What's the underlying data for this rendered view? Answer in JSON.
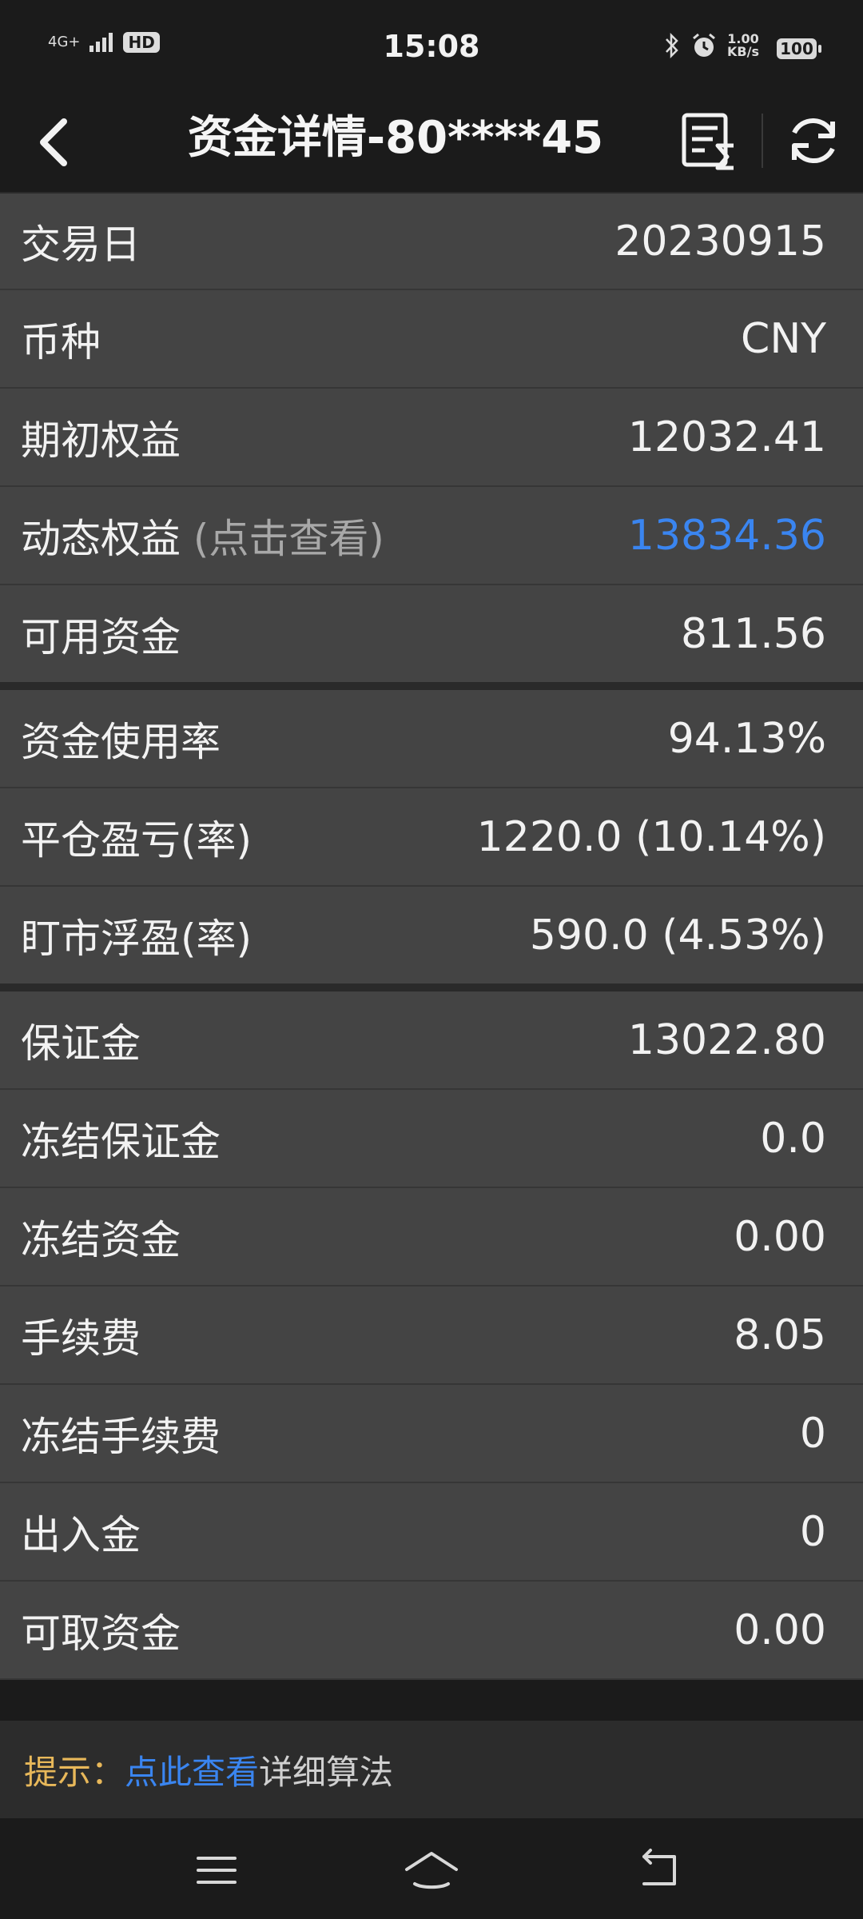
{
  "status": {
    "network": "4G+",
    "hd": "HD",
    "time": "15:08",
    "speed_value": "1.00",
    "speed_unit": "KB/s",
    "battery": "100"
  },
  "header": {
    "title": "资金详情-80****45"
  },
  "rows": [
    {
      "label": "交易日",
      "value": "20230915"
    },
    {
      "label": "币种",
      "value": "CNY"
    },
    {
      "label": "期初权益",
      "value": "12032.41"
    },
    {
      "label": "动态权益",
      "hint": "(点击查看)",
      "value": "13834.36"
    },
    {
      "label": "可用资金",
      "value": "811.56"
    },
    {
      "label": "资金使用率",
      "value": "94.13%"
    },
    {
      "label": "平仓盈亏(率)",
      "value": "1220.0 (10.14%)"
    },
    {
      "label": "盯市浮盈(率)",
      "value": "590.0 (4.53%)"
    },
    {
      "label": "保证金",
      "value": "13022.80"
    },
    {
      "label": "冻结保证金",
      "value": "0.0"
    },
    {
      "label": "冻结资金",
      "value": "0.00"
    },
    {
      "label": "手续费",
      "value": "8.05"
    },
    {
      "label": "冻结手续费",
      "value": "0"
    },
    {
      "label": "出入金",
      "value": "0"
    },
    {
      "label": "可取资金",
      "value": "0.00"
    }
  ],
  "tip": {
    "prefix": "提示：",
    "link": "点此查看",
    "rest": "详细算法"
  },
  "colors": {
    "accent_blue": "#3a85f0",
    "tip_yellow": "#e8b85a",
    "row_bg": "#444444",
    "page_bg": "#1b1b1b"
  }
}
